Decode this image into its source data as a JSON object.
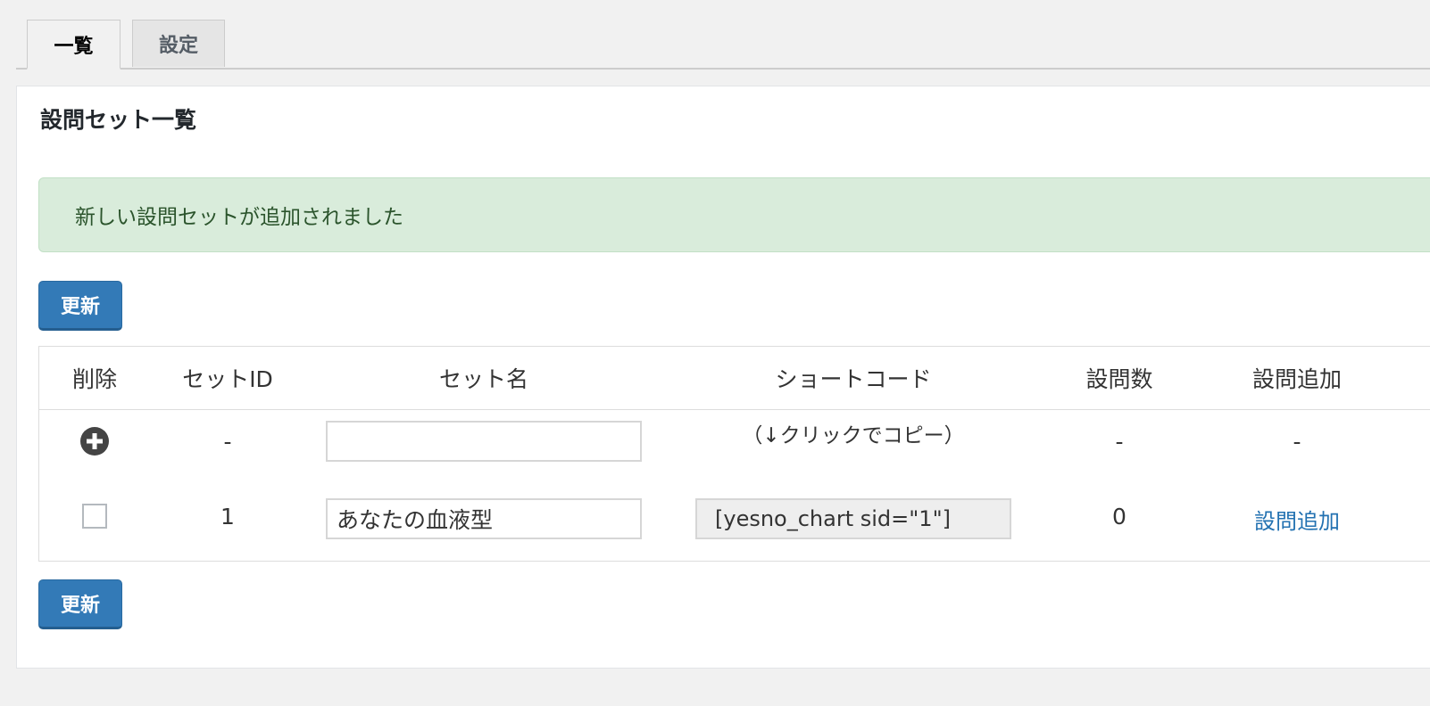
{
  "tabs": [
    {
      "label": "一覧",
      "active": true
    },
    {
      "label": "設定",
      "active": false
    }
  ],
  "panel": {
    "title": "設問セット一覧"
  },
  "notice": {
    "message": "新しい設問セットが追加されました"
  },
  "buttons": {
    "update_label": "更新"
  },
  "table": {
    "headers": [
      "削除",
      "セットID",
      "セット名",
      "ショートコード",
      "設問数",
      "設問追加"
    ],
    "new_row": {
      "id": "-",
      "name_value": "",
      "code_hint": "（↓クリックでコピー）",
      "count": "-",
      "add": "-"
    },
    "rows": [
      {
        "id": "1",
        "name_value": "あなたの血液型",
        "shortcode": "[yesno_chart sid=\"1\"]",
        "count": "0",
        "add_link": "設問追加"
      }
    ]
  },
  "colors": {
    "primary_button": "#337ab7",
    "notice_bg": "#d9ecdb",
    "notice_text": "#2b542c",
    "link": "#2271b1"
  }
}
